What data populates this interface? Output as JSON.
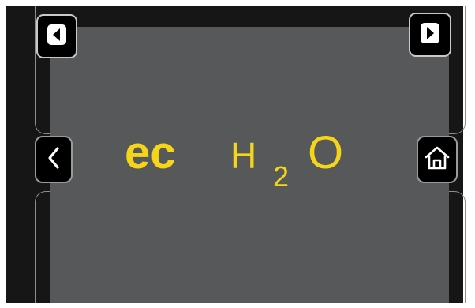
{
  "device": {
    "brand_logo": {
      "part1": "ec",
      "part2": "H",
      "subscript": "2",
      "part3": "O",
      "color": "#f5d51a"
    }
  },
  "controls": {
    "prev_icon": "triangle-left-icon",
    "next_icon": "triangle-right-icon",
    "back_icon": "chevron-left-icon",
    "home_icon": "home-icon"
  },
  "colors": {
    "screen": "#56585a",
    "bezel": "#161616",
    "button_bg": "#000000",
    "button_border": "#c9c9c9",
    "icon": "#ffffff"
  }
}
